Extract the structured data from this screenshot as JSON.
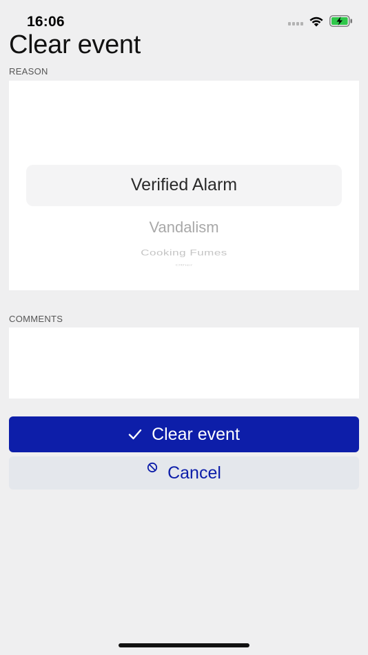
{
  "status_bar": {
    "time": "16:06"
  },
  "page": {
    "title": "Clear event"
  },
  "reason": {
    "label": "REASON",
    "selected": "Verified Alarm",
    "options_below": [
      "Vandalism",
      "Cooking Fumes",
      "Other"
    ]
  },
  "comments": {
    "label": "COMMENTS",
    "value": ""
  },
  "actions": {
    "clear_label": "Clear event",
    "cancel_label": "Cancel"
  },
  "colors": {
    "primary": "#0d1ea9",
    "secondary_bg": "#e4e7ec",
    "background": "#efeff0",
    "battery": "#2fc74a"
  },
  "icons": {
    "clear": "checkmark-icon",
    "cancel": "prohibit-icon"
  }
}
